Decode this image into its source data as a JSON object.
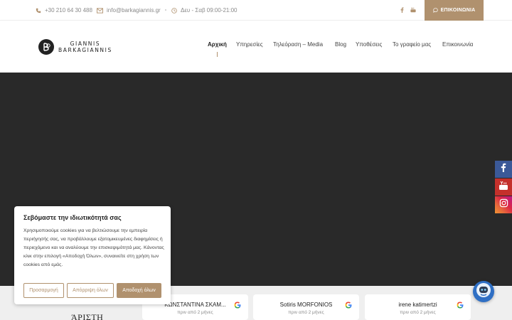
{
  "topbar": {
    "phone": "+30 210 64 30 488",
    "email": "info@barkagiannis.gr",
    "hours": "Δευ - Σαβ 09:00-21:00",
    "social_icons": [
      "facebook-icon",
      "youtube-icon"
    ],
    "contact_label": "ΕΠΙΚΟΙΝΩΝΙΑ"
  },
  "header": {
    "logo_line1": "GIANNIS",
    "logo_line2": "BARKAGIANNIS",
    "nav": [
      {
        "label": "Αρχική",
        "active": true
      },
      {
        "label": "Υπηρεσίες",
        "active": false
      },
      {
        "label": "Τηλεόραση – Media",
        "active": false
      },
      {
        "label": "Blog",
        "active": false
      },
      {
        "label": "Υποθέσεις",
        "active": false
      },
      {
        "label": "Το γραφείο μας",
        "active": false
      },
      {
        "label": "Επικοινωνία",
        "active": false
      }
    ]
  },
  "colors": {
    "accent": "#b0916e",
    "hero": "#292929",
    "facebook": "#3b5998",
    "youtube": "#c4302b"
  },
  "float_social": [
    "facebook-icon",
    "youtube-icon",
    "instagram-icon"
  ],
  "cookie": {
    "title": "Σεβόμαστε την ιδιωτικότητά σας",
    "body": "Χρησιμοποιούμε cookies για να βελτιώσουμε την εμπειρία περιήγησής σας, να προβάλλουμε εξατομικευμένες διαφημίσεις ή περιεχόμενο και να αναλύουμε την επισκεψιμότητά μας. Κάνοντας κλικ στην επιλογή «Αποδοχή Όλων», συναινείτε στη χρήση των cookies από εμάς.",
    "btn_customize": "Προσαρμογή",
    "btn_reject": "Απόρριψη όλων",
    "btn_accept": "Αποδοχή όλων"
  },
  "reviews_heading": "ΆΡΙΣΤΗ",
  "reviews": [
    {
      "name": "ΚΩΝΣΤΑΝΤΙΝΑ ΣΚΑΜ...",
      "time": "πριν από 2 μήνες"
    },
    {
      "name": "Sotiris MORFONIOS",
      "time": "πριν από 2 μήνες"
    },
    {
      "name": "irene katimertzi",
      "time": "πριν από 2 μήνες"
    }
  ]
}
